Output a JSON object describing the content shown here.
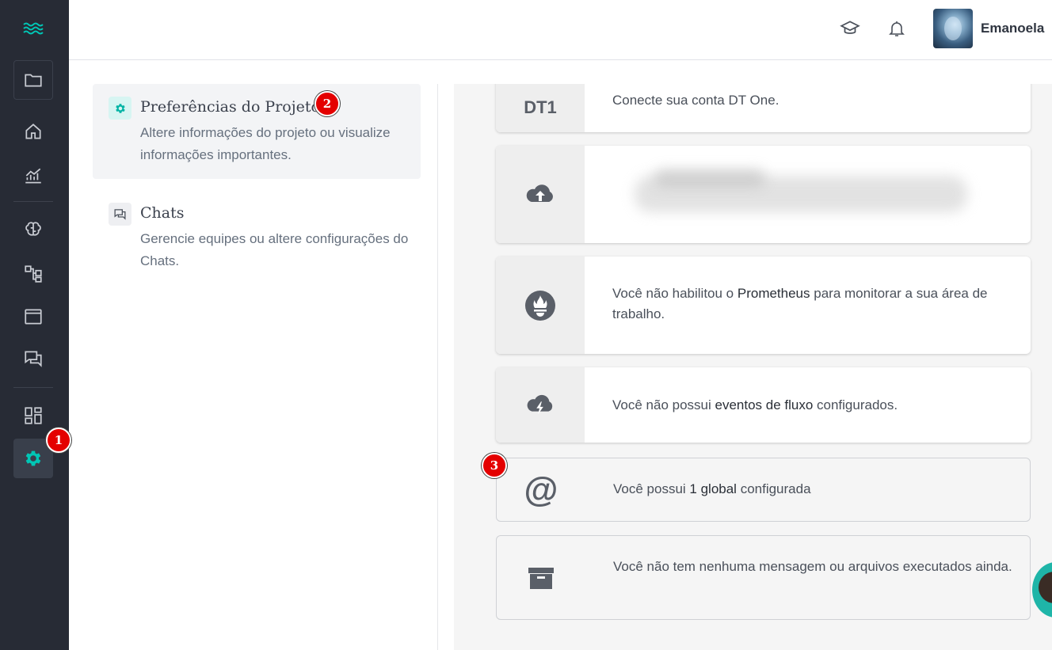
{
  "user": {
    "name": "Emanoela"
  },
  "sidebar": {
    "items": [
      {
        "name": "folder"
      },
      {
        "name": "home"
      },
      {
        "name": "analytics"
      },
      {
        "name": "brain"
      },
      {
        "name": "flows"
      },
      {
        "name": "window"
      },
      {
        "name": "chats"
      },
      {
        "name": "dashboard"
      },
      {
        "name": "settings"
      }
    ]
  },
  "settings_menu": {
    "items": [
      {
        "title": "Preferências do Projeto",
        "description": "Altere informações do projeto ou visualize informações importantes."
      },
      {
        "title": "Chats",
        "description": "Gerencie equipes ou altere configurações do Chats."
      }
    ]
  },
  "cards": {
    "dt_one": {
      "logo": "DT1",
      "text": "Conecte sua conta DT One."
    },
    "prometheus": {
      "pre": "Você não habilitou o ",
      "bold": "Prometheus",
      "post": " para monitorar a sua área de trabalho."
    },
    "flow_events": {
      "pre": "Você não possui ",
      "bold": "eventos de fluxo",
      "post": " configurados."
    },
    "globals": {
      "pre": "Você possui ",
      "bold": "1 global",
      "post": " configurada"
    },
    "messages": {
      "text": "Você não tem nenhuma mensagem ou arquivos executados ainda."
    }
  },
  "badges": [
    "1",
    "2",
    "3"
  ],
  "colors": {
    "sidebar_bg": "#272b35",
    "accent": "#00c6b5",
    "badge": "#e40000"
  }
}
